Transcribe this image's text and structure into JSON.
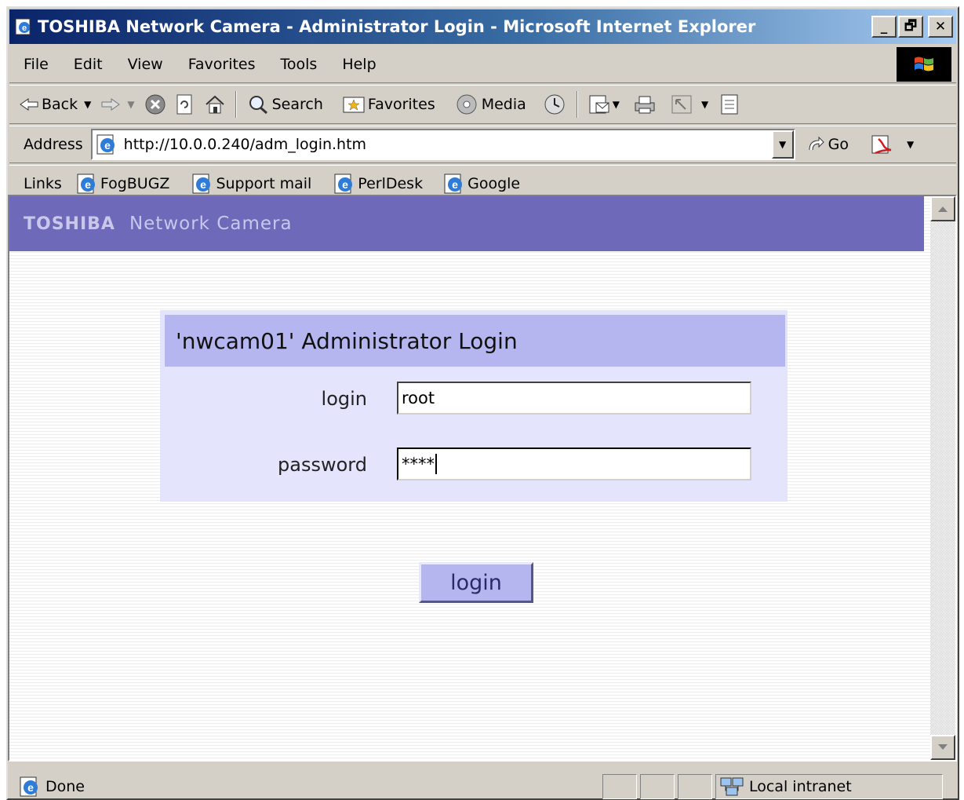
{
  "window": {
    "title": "TOSHIBA Network Camera - Administrator Login - Microsoft Internet Explorer",
    "controls": {
      "minimize": "_",
      "maximize": "🗗",
      "close": "✕"
    }
  },
  "menu": [
    "File",
    "Edit",
    "View",
    "Favorites",
    "Tools",
    "Help"
  ],
  "toolbar": {
    "back_label": "Back",
    "search_label": "Search",
    "favorites_label": "Favorites",
    "media_label": "Media"
  },
  "address": {
    "label": "Address",
    "url": "http://10.0.0.240/adm_login.htm",
    "go_label": "Go"
  },
  "links": {
    "label": "Links",
    "items": [
      "FogBUGZ",
      "Support mail",
      "PerlDesk",
      "Google"
    ]
  },
  "page": {
    "brand": "TOSHIBA",
    "product": "Network Camera",
    "login_title": "'nwcam01' Administrator Login",
    "login_label": "login",
    "login_value": "root",
    "password_label": "password",
    "password_value": "****",
    "submit_label": "login"
  },
  "status": {
    "text": "Done",
    "zone": "Local intranet"
  },
  "colors": {
    "titlebar_start": "#0a246a",
    "banner": "#6e6ab9",
    "panel_header": "#b5b5f0",
    "panel_body": "#e4e4fc"
  },
  "icons": [
    "ie-page-icon",
    "windows-flag-icon",
    "back-arrow-icon",
    "forward-arrow-icon",
    "stop-icon",
    "refresh-icon",
    "home-icon",
    "search-icon",
    "favorites-icon",
    "media-icon",
    "history-icon",
    "mail-icon",
    "print-icon",
    "edit-icon",
    "discuss-icon",
    "go-arrow-icon",
    "acrobat-icon",
    "local-intranet-icon"
  ]
}
